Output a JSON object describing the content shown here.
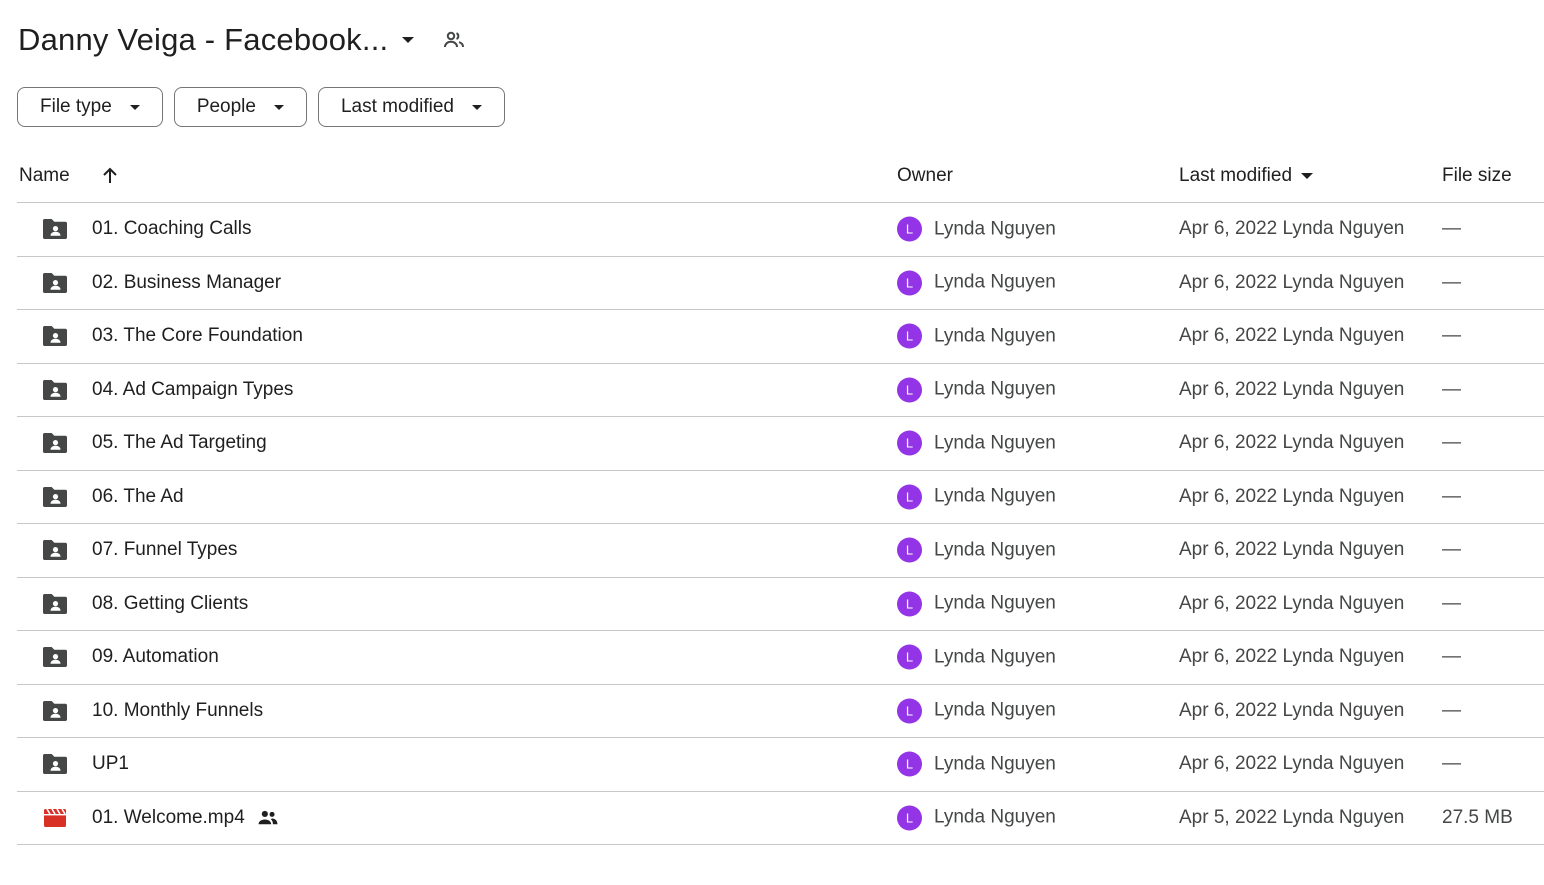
{
  "header": {
    "title": "Danny Veiga - Facebook...",
    "caret_icon": "dropdown-caret-icon",
    "shared_icon": "people-icon"
  },
  "filters": [
    {
      "label": "File type"
    },
    {
      "label": "People"
    },
    {
      "label": "Last modified"
    }
  ],
  "table": {
    "columns": {
      "name": "Name",
      "owner": "Owner",
      "last_modified": "Last modified",
      "file_size": "File size"
    },
    "sort_icon": "arrow-up-icon",
    "rows": [
      {
        "type": "shared-folder",
        "name": "01. Coaching Calls",
        "owner_initial": "L",
        "owner": "Lynda Nguyen",
        "modified": "Apr 6, 2022 Lynda Nguyen",
        "size": "—"
      },
      {
        "type": "shared-folder",
        "name": "02. Business Manager",
        "owner_initial": "L",
        "owner": "Lynda Nguyen",
        "modified": "Apr 6, 2022 Lynda Nguyen",
        "size": "—"
      },
      {
        "type": "shared-folder",
        "name": "03. The Core Foundation",
        "owner_initial": "L",
        "owner": "Lynda Nguyen",
        "modified": "Apr 6, 2022 Lynda Nguyen",
        "size": "—"
      },
      {
        "type": "shared-folder",
        "name": "04. Ad Campaign Types",
        "owner_initial": "L",
        "owner": "Lynda Nguyen",
        "modified": "Apr 6, 2022 Lynda Nguyen",
        "size": "—"
      },
      {
        "type": "shared-folder",
        "name": "05. The Ad Targeting",
        "owner_initial": "L",
        "owner": "Lynda Nguyen",
        "modified": "Apr 6, 2022 Lynda Nguyen",
        "size": "—"
      },
      {
        "type": "shared-folder",
        "name": "06. The Ad",
        "owner_initial": "L",
        "owner": "Lynda Nguyen",
        "modified": "Apr 6, 2022 Lynda Nguyen",
        "size": "—"
      },
      {
        "type": "shared-folder",
        "name": "07. Funnel Types",
        "owner_initial": "L",
        "owner": "Lynda Nguyen",
        "modified": "Apr 6, 2022 Lynda Nguyen",
        "size": "—"
      },
      {
        "type": "shared-folder",
        "name": "08. Getting Clients",
        "owner_initial": "L",
        "owner": "Lynda Nguyen",
        "modified": "Apr 6, 2022 Lynda Nguyen",
        "size": "—"
      },
      {
        "type": "shared-folder",
        "name": "09. Automation",
        "owner_initial": "L",
        "owner": "Lynda Nguyen",
        "modified": "Apr 6, 2022 Lynda Nguyen",
        "size": "—"
      },
      {
        "type": "shared-folder",
        "name": "10. Monthly Funnels",
        "owner_initial": "L",
        "owner": "Lynda Nguyen",
        "modified": "Apr 6, 2022 Lynda Nguyen",
        "size": "—"
      },
      {
        "type": "shared-folder",
        "name": "UP1",
        "owner_initial": "L",
        "owner": "Lynda Nguyen",
        "modified": "Apr 6, 2022 Lynda Nguyen",
        "size": "—"
      },
      {
        "type": "video",
        "name": "01. Welcome.mp4",
        "shared": true,
        "owner_initial": "L",
        "owner": "Lynda Nguyen",
        "modified": "Apr 5, 2022 Lynda Nguyen",
        "size": "27.5 MB"
      }
    ]
  },
  "colors": {
    "avatar": "#9334e6",
    "folder_icon": "#444746",
    "video_icon": "#d93025",
    "divider": "#c7c7c7"
  }
}
